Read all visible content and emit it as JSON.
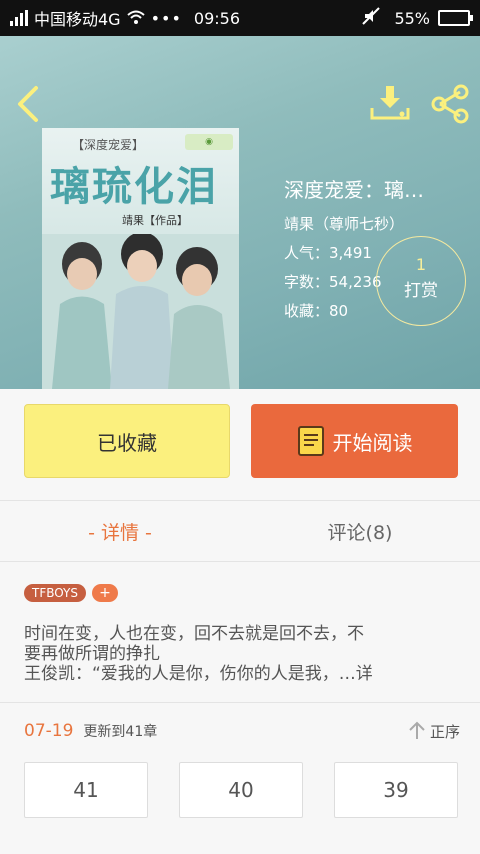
{
  "status_bar": {
    "carrier": "中国移动4G",
    "dots": "•••",
    "time": "09:56",
    "battery": "55%",
    "battery_level": 0.55
  },
  "header": {
    "back_icon": "chevron-left-icon",
    "download_icon": "download-icon",
    "share_icon": "share-icon"
  },
  "cover": {
    "series": "【深度宠爱】",
    "title": "璃琉化泪",
    "author": "靖果【作品】"
  },
  "book": {
    "title": "深度宠爱：璃…",
    "author": "靖果（尊师七秒）",
    "popularity": "人气：3,491",
    "word_count": "字数：54,236",
    "favorites": "收藏：80"
  },
  "tip": {
    "count": "1",
    "label": "打赏"
  },
  "actions": {
    "collected_label": "已收藏",
    "read_label": "开始阅读"
  },
  "tabs": [
    {
      "label": "- 详情 -",
      "active": true
    },
    {
      "label": "评论(8)",
      "active": false
    }
  ],
  "tags": {
    "items": [
      "TFBOYS"
    ],
    "add_label": "+"
  },
  "description": {
    "lines": [
      "时间在变，人也在变，回不去就是回不去，不",
      "要再做所谓的挣扎",
      "王俊凯：“爱我的人是你，伤你的人是我，…详"
    ]
  },
  "updates": {
    "date": "07-19",
    "text": "更新到41章",
    "sort_label": "正序"
  },
  "chapters": [
    "41",
    "40",
    "39"
  ],
  "colors": {
    "accent": "#e8753e",
    "read_button": "#ea693d",
    "collected_button": "#fbf07e"
  }
}
